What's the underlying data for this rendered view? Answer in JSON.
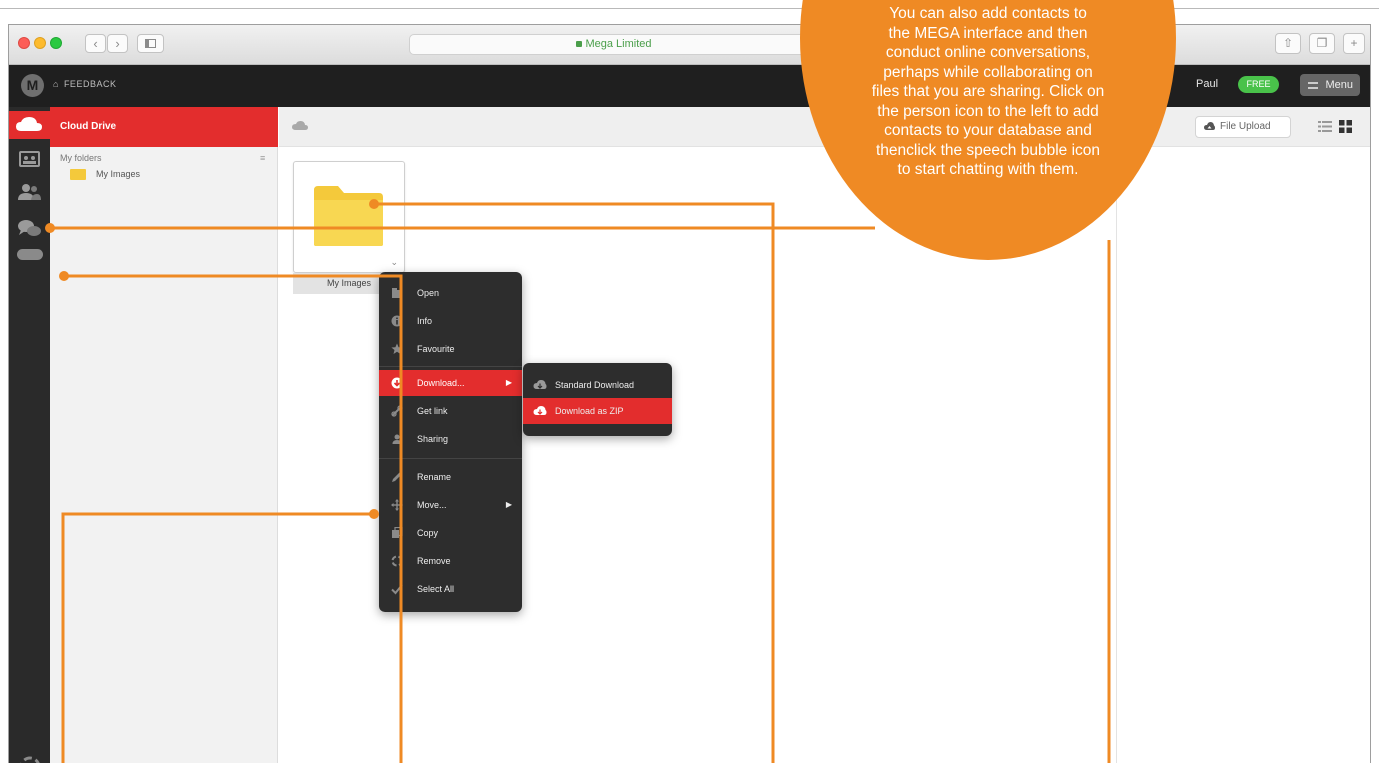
{
  "browser": {
    "url_label": "Mega Limited",
    "lock_icon": "lock-icon"
  },
  "appbar": {
    "logo_letter": "M",
    "feedback_label": "FEEDBACK",
    "user_name": "Paul",
    "plan_badge": "FREE",
    "menu_label": "Menu"
  },
  "rail": {
    "icons": [
      "cloud-drive-icon",
      "shared-folders-icon",
      "contacts-icon",
      "chat-icon",
      "beta-icon",
      "rubbish-bin-icon"
    ]
  },
  "folder_panel": {
    "header": "Cloud Drive",
    "section_label": "My folders",
    "section_caret": "≡",
    "tree": [
      {
        "label": "My Images"
      }
    ]
  },
  "main": {
    "folder_tile_label": "My Images"
  },
  "right_panel": {
    "upload_label": "File Upload"
  },
  "context_menu": {
    "items": [
      {
        "label": "Open",
        "icon": "open-icon"
      },
      {
        "label": "Info",
        "icon": "info-icon"
      },
      {
        "label": "Favourite",
        "icon": "star-icon"
      },
      {
        "label": "Download...",
        "icon": "download-icon",
        "active": true,
        "has_submenu": true
      },
      {
        "label": "Get link",
        "icon": "link-icon"
      },
      {
        "label": "Sharing",
        "icon": "share-icon"
      },
      {
        "label": "Rename",
        "icon": "pencil-icon"
      },
      {
        "label": "Move...",
        "icon": "move-icon",
        "has_submenu": true
      },
      {
        "label": "Copy",
        "icon": "copy-icon"
      },
      {
        "label": "Remove",
        "icon": "trash-icon"
      },
      {
        "label": "Select All",
        "icon": "check-icon"
      }
    ]
  },
  "download_submenu": {
    "items": [
      {
        "label": "Standard Download",
        "icon": "cloud-download-icon"
      },
      {
        "label": "Download as ZIP",
        "icon": "zip-download-icon",
        "active": true
      }
    ]
  },
  "callout": {
    "lines": [
      "You can also add contacts to",
      "the MEGA interface and then",
      "conduct online conversations,",
      "perhaps while collaborating on",
      "files that you are sharing. Click on",
      "the person icon to the left to add",
      "contacts to your database and",
      "thenclick the speech bubble icon",
      "to start chatting with them."
    ]
  },
  "colors": {
    "accent_red": "#e32d2d",
    "callout_orange": "#ef8a24",
    "free_green": "#49c24a"
  }
}
